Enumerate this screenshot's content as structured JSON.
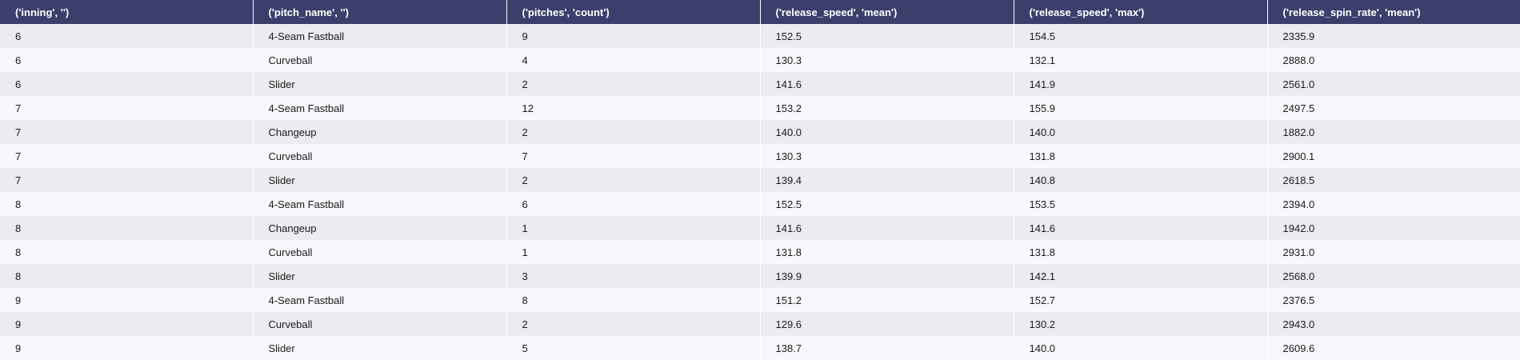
{
  "colors": {
    "header_bg": "#3a3f6b",
    "header_text": "#ffffff",
    "row_odd": "#ebecf0",
    "row_even": "#f7f8fc"
  },
  "table": {
    "headers": [
      "('inning', '')",
      "('pitch_name', '')",
      "('pitches', 'count')",
      "('release_speed', 'mean')",
      "('release_speed', 'max')",
      "('release_spin_rate', 'mean')"
    ],
    "rows": [
      [
        "6",
        "4-Seam Fastball",
        "9",
        "152.5",
        "154.5",
        "2335.9"
      ],
      [
        "6",
        "Curveball",
        "4",
        "130.3",
        "132.1",
        "2888.0"
      ],
      [
        "6",
        "Slider",
        "2",
        "141.6",
        "141.9",
        "2561.0"
      ],
      [
        "7",
        "4-Seam Fastball",
        "12",
        "153.2",
        "155.9",
        "2497.5"
      ],
      [
        "7",
        "Changeup",
        "2",
        "140.0",
        "140.0",
        "1882.0"
      ],
      [
        "7",
        "Curveball",
        "7",
        "130.3",
        "131.8",
        "2900.1"
      ],
      [
        "7",
        "Slider",
        "2",
        "139.4",
        "140.8",
        "2618.5"
      ],
      [
        "8",
        "4-Seam Fastball",
        "6",
        "152.5",
        "153.5",
        "2394.0"
      ],
      [
        "8",
        "Changeup",
        "1",
        "141.6",
        "141.6",
        "1942.0"
      ],
      [
        "8",
        "Curveball",
        "1",
        "131.8",
        "131.8",
        "2931.0"
      ],
      [
        "8",
        "Slider",
        "3",
        "139.9",
        "142.1",
        "2568.0"
      ],
      [
        "9",
        "4-Seam Fastball",
        "8",
        "151.2",
        "152.7",
        "2376.5"
      ],
      [
        "9",
        "Curveball",
        "2",
        "129.6",
        "130.2",
        "2943.0"
      ],
      [
        "9",
        "Slider",
        "5",
        "138.7",
        "140.0",
        "2609.6"
      ]
    ]
  }
}
